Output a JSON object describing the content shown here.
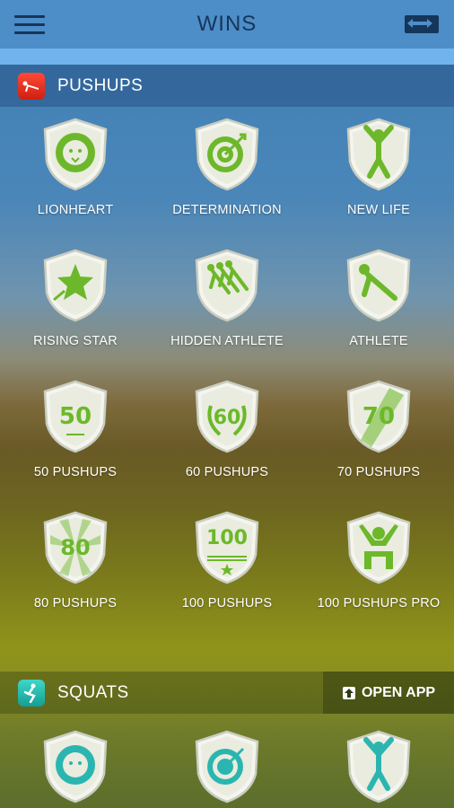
{
  "header": {
    "title": "WINS",
    "menu_icon": "hamburger-menu-icon",
    "switch_icon": "switch-apps-icon"
  },
  "colors": {
    "topbar": "#4d8dc8",
    "accent_strip": "#6fb4ec",
    "badge_green": "#6cb82a",
    "title_text": "#15365a"
  },
  "pushups": {
    "title": "PUSHUPS",
    "icon": "pushup-app-icon",
    "badges": [
      {
        "label": "LIONHEART",
        "icon": "lion-icon"
      },
      {
        "label": "DETERMINATION",
        "icon": "target-icon"
      },
      {
        "label": "NEW LIFE",
        "icon": "jumping-person-icon"
      },
      {
        "label": "RISING STAR",
        "icon": "star-icon"
      },
      {
        "label": "HIDDEN ATHLETE",
        "icon": "pushup-people-icon"
      },
      {
        "label": "ATHLETE",
        "icon": "pushup-person-icon"
      },
      {
        "label": "50 PUSHUPS",
        "icon": "fifty-badge-icon",
        "number": "50"
      },
      {
        "label": "60 PUSHUPS",
        "icon": "sixty-laurel-icon",
        "number": "60"
      },
      {
        "label": "70 PUSHUPS",
        "icon": "seventy-stripe-icon",
        "number": "70"
      },
      {
        "label": "80 PUSHUPS",
        "icon": "eighty-rays-icon",
        "number": "80"
      },
      {
        "label": "100 PUSHUPS",
        "icon": "hundred-stars-icon",
        "number": "100"
      },
      {
        "label": "100 PUSHUPS PRO",
        "icon": "champion-icon"
      }
    ]
  },
  "squats": {
    "title": "SQUATS",
    "icon": "squat-app-icon",
    "open_app": "OPEN APP",
    "badges": [
      {
        "icon": "lion-icon"
      },
      {
        "icon": "target-icon"
      },
      {
        "icon": "jumping-person-icon"
      }
    ]
  }
}
